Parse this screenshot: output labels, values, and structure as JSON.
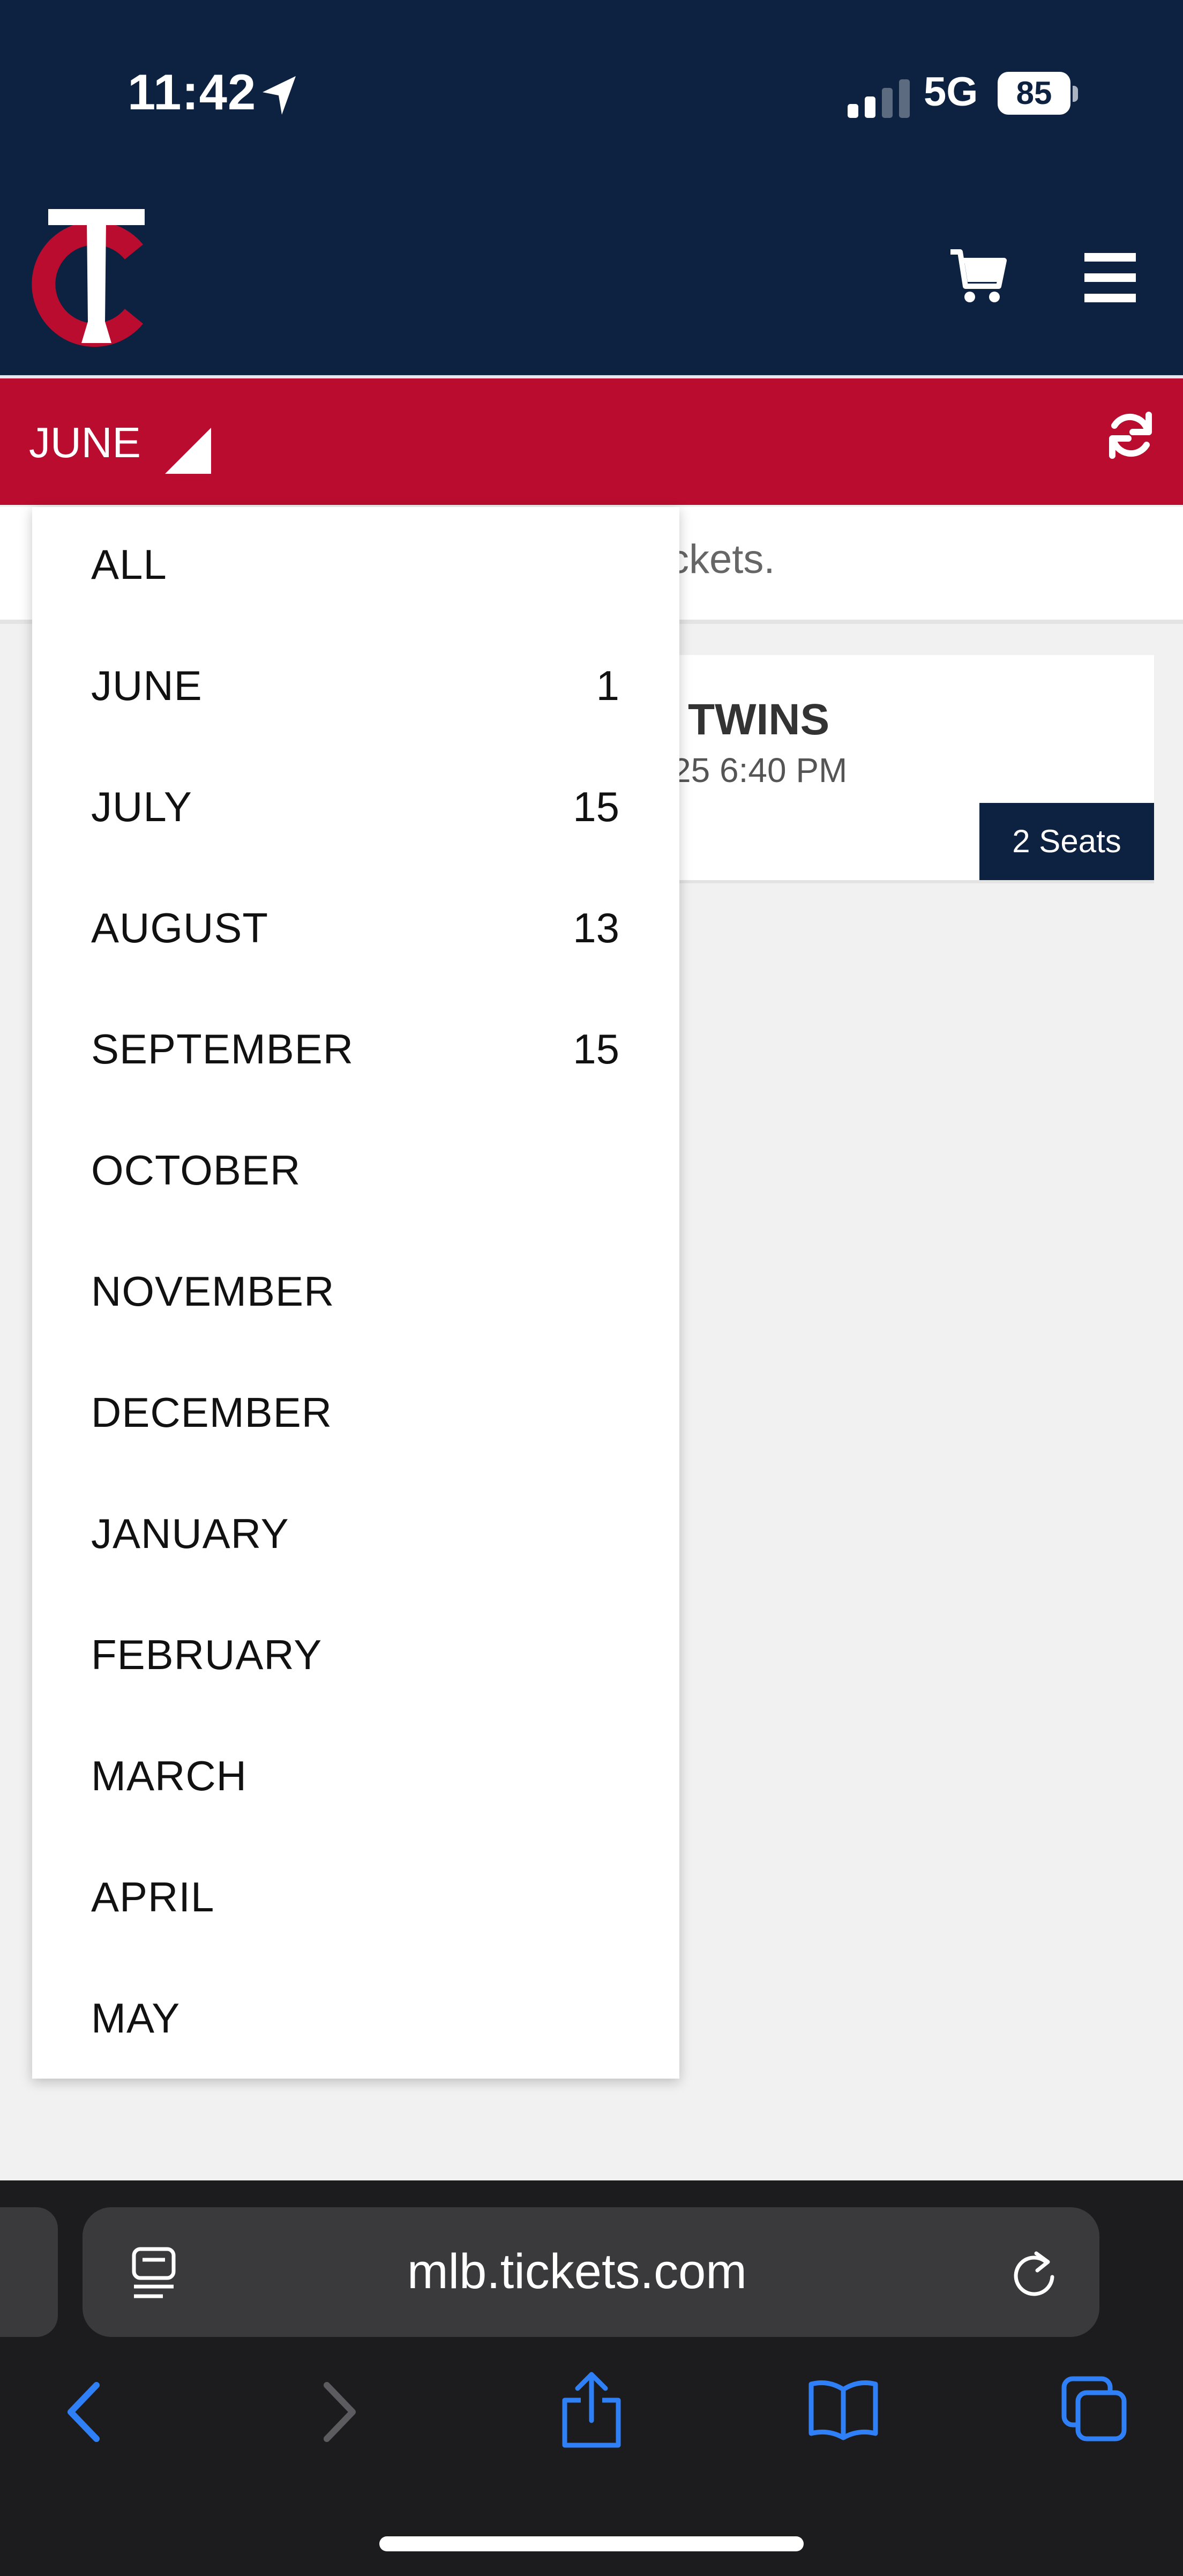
{
  "status_bar": {
    "time": "11:42",
    "network": "5G",
    "battery": "85"
  },
  "header": {
    "logo_icon": "twins-tc-logo",
    "cart_icon": "cart-icon",
    "menu_icon": "hamburger-menu-icon"
  },
  "filter_bar": {
    "selected_month": "JUNE",
    "refresh_icon": "refresh-icon"
  },
  "dropdown": {
    "options": [
      {
        "label": "ALL",
        "count": ""
      },
      {
        "label": "JUNE",
        "count": "1"
      },
      {
        "label": "JULY",
        "count": "15"
      },
      {
        "label": "AUGUST",
        "count": "13"
      },
      {
        "label": "SEPTEMBER",
        "count": "15"
      },
      {
        "label": "OCTOBER",
        "count": ""
      },
      {
        "label": "NOVEMBER",
        "count": ""
      },
      {
        "label": "DECEMBER",
        "count": ""
      },
      {
        "label": "JANUARY",
        "count": ""
      },
      {
        "label": "FEBRUARY",
        "count": ""
      },
      {
        "label": "MARCH",
        "count": ""
      },
      {
        "label": "APRIL",
        "count": ""
      },
      {
        "label": "MAY",
        "count": ""
      }
    ]
  },
  "background": {
    "notice_text": "ckets.",
    "game_title": "TWINS",
    "game_date": "25 6:40 PM",
    "seats_label": "2 Seats"
  },
  "browser": {
    "url": "mlb.tickets.com"
  },
  "colors": {
    "navy": "#0c2240",
    "red": "#ba0c2f",
    "link_blue": "#2f7ff7"
  }
}
